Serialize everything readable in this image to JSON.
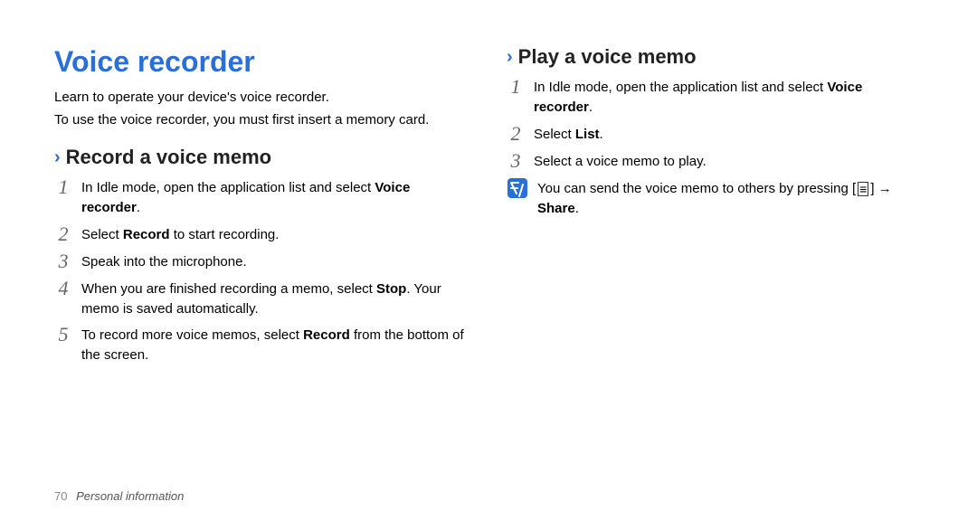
{
  "title": "Voice recorder",
  "intro_line1": "Learn to operate your device's voice recorder.",
  "intro_line2": "To use the voice recorder, you must first insert a memory card.",
  "section_record": {
    "heading": "Record a voice memo",
    "steps": {
      "s1a": "In Idle mode, open the application list and select ",
      "s1b": "Voice recorder",
      "s1c": ".",
      "s2a": "Select ",
      "s2b": "Record",
      "s2c": " to start recording.",
      "s3": "Speak into the microphone.",
      "s4a": "When you are finished recording a memo, select ",
      "s4b": "Stop",
      "s4c": ". Your memo is saved automatically.",
      "s5a": "To record more voice memos, select ",
      "s5b": "Record",
      "s5c": " from the bottom of the screen."
    }
  },
  "section_play": {
    "heading": "Play a voice memo",
    "steps": {
      "s1a": "In Idle mode, open the application list and select ",
      "s1b": "Voice recorder",
      "s1c": ".",
      "s2a": "Select ",
      "s2b": "List",
      "s2c": ".",
      "s3": "Select a voice memo to play."
    },
    "note_a": "You can send the voice memo to others by pressing [",
    "note_menu": "≡",
    "note_b": "] → ",
    "note_c": "Share",
    "note_d": "."
  },
  "footer": {
    "page": "70",
    "section": "Personal information"
  }
}
